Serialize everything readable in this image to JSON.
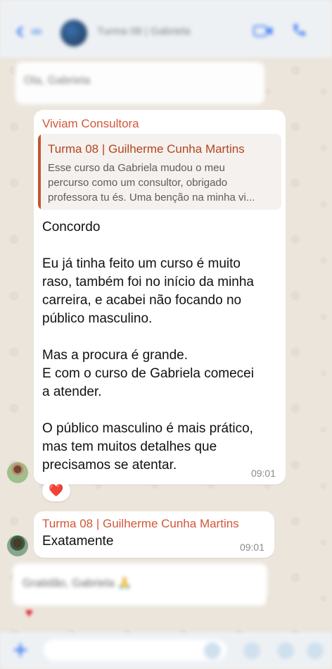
{
  "header": {
    "title": "Turma 08 | Gabriela",
    "back_icon": "chevron-left-icon",
    "video_icon": "video-call-icon",
    "call_icon": "phone-icon",
    "accent": "#3478f6"
  },
  "prev_message": {
    "text": "Ola, Gabriela"
  },
  "message_1": {
    "sender": "Viviam Consultora",
    "sender_color": "#d2573a",
    "quoted": {
      "sender": "Turma 08 | Guilherme Cunha Martins",
      "lines": [
        "Esse curso da Gabriela mudou o meu",
        "percurso como um consultor, obrigado",
        "professora tu és. Uma benção na minha vi..."
      ]
    },
    "paragraphs": [
      [
        "Concordo"
      ],
      [
        "Eu já tinha feito um curso é muito",
        "raso, também foi no início da minha",
        "carreira, e acabei não focando no",
        "público masculino."
      ],
      [
        "Mas a procura é grande.",
        "E com o curso de Gabriela comecei",
        "a atender."
      ],
      [
        "O público masculino é mais prático,",
        "mas tem muitos detalhes que",
        "precisamos se atentar."
      ]
    ],
    "time": "09:01",
    "reaction": "❤️"
  },
  "message_2": {
    "sender": "Turma 08 | Guilherme Cunha Martins",
    "text": "Exatamente",
    "time": "09:01"
  },
  "next_message": {
    "text": "Gratidão, Gabriela 🙏"
  },
  "input_bar": {
    "plus_icon": "plus-icon",
    "sticker_icon": "sticker-icon",
    "camera_icon": "camera-icon",
    "mic_icon": "microphone-icon"
  }
}
